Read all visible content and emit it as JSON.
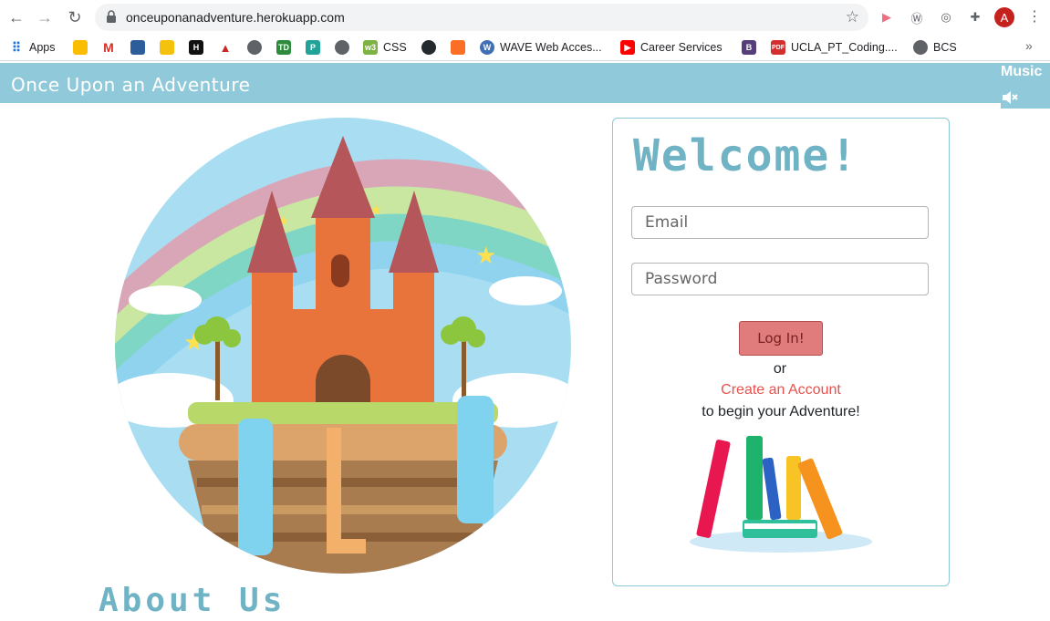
{
  "browser": {
    "url": "onceuponanadventure.herokuapp.com",
    "profile_initial": "A"
  },
  "bookmarks": {
    "items": [
      {
        "label": "Apps"
      },
      {
        "label": "CSS"
      },
      {
        "label": "WAVE Web Acces..."
      },
      {
        "label": "Career Services"
      },
      {
        "label": "UCLA_PT_Coding...."
      },
      {
        "label": "BCS"
      }
    ],
    "more": "»"
  },
  "header": {
    "title": "Once Upon an Adventure",
    "music_label": "Music"
  },
  "login": {
    "heading": "Welcome!",
    "email_placeholder": "Email",
    "password_placeholder": "Password",
    "login_label": "Log In!",
    "or_text": "or",
    "create_link": "Create an Account",
    "begin_text": "to begin your Adventure!"
  },
  "about": {
    "heading": "About Us"
  },
  "colors": {
    "nav": "#90cada",
    "accent": "#6fb3c4",
    "login_button": "#e07c7c",
    "link": "#e8524e"
  }
}
